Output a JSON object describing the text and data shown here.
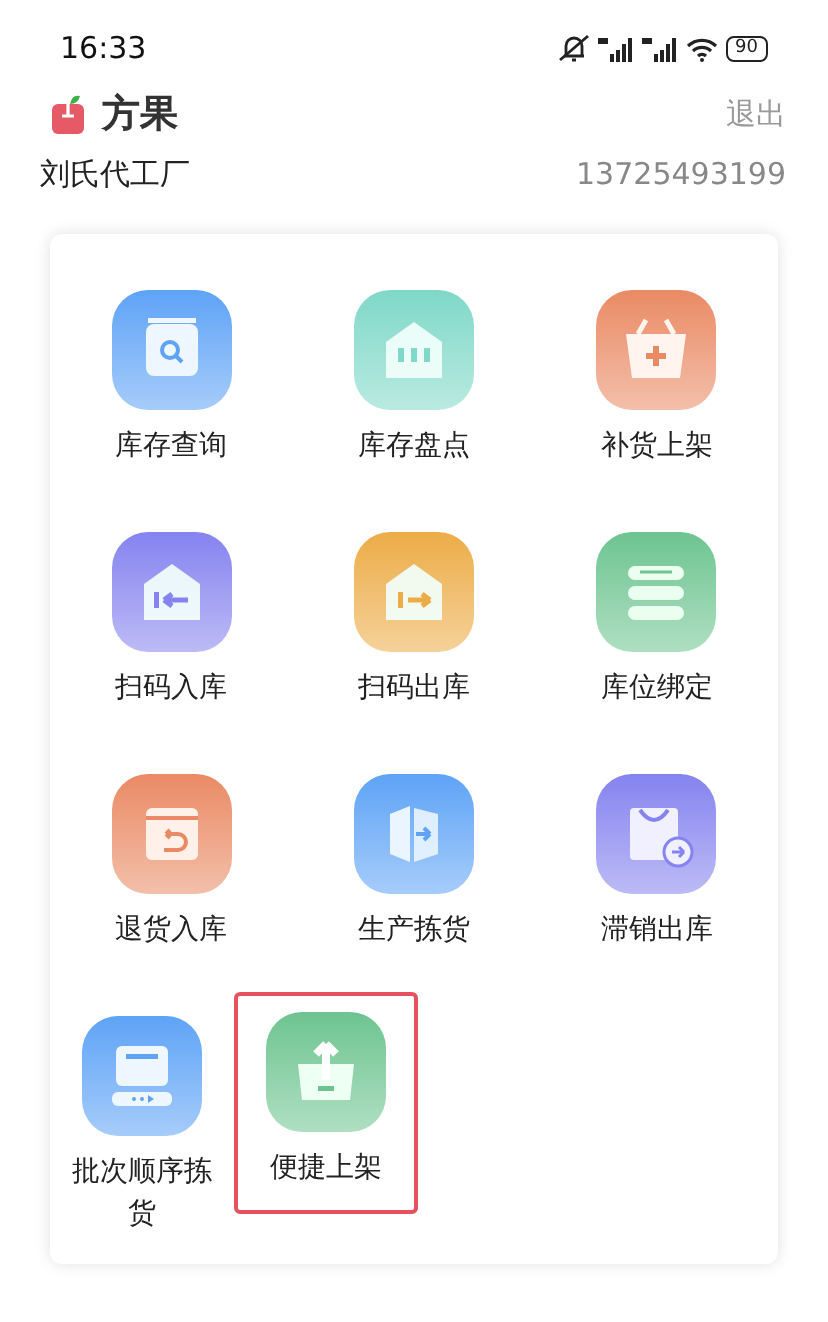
{
  "status_bar": {
    "time": "16:33",
    "battery": "90"
  },
  "header": {
    "app_name": "方果",
    "logout": "退出",
    "company": "刘氏代工厂",
    "phone": "13725493199"
  },
  "main_items": [
    {
      "label": "库存查询",
      "color": "#5ea3f6"
    },
    {
      "label": "库存盘点",
      "color": "#7fd8c8"
    },
    {
      "label": "补货上架",
      "color": "#ea8a64"
    },
    {
      "label": "扫码入库",
      "color": "#8583ef"
    },
    {
      "label": "扫码出库",
      "color": "#ecac47"
    },
    {
      "label": "库位绑定",
      "color": "#6dc490"
    },
    {
      "label": "退货入库",
      "color": "#ea8a64"
    },
    {
      "label": "生产拣货",
      "color": "#5ea3f6"
    },
    {
      "label": "滞销出库",
      "color": "#8583ef"
    }
  ],
  "extra_items": [
    {
      "label": "批次顺序拣货",
      "color": "#5ea3f6",
      "selected": false
    },
    {
      "label": "便捷上架",
      "color": "#6dc490",
      "selected": true
    }
  ]
}
